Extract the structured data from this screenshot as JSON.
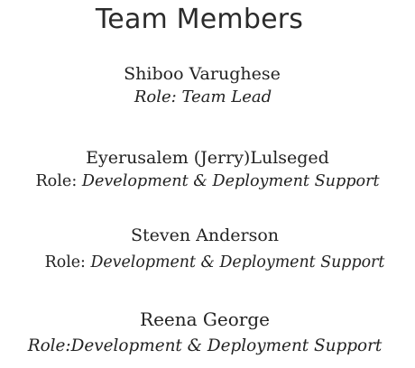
{
  "page": {
    "title": "Team Members"
  },
  "members": [
    {
      "name": "Shiboo Varughese",
      "role_prefix": "Role:",
      "role_value": " Team Lead"
    },
    {
      "name": "Eyerusalem (Jerry)Lulseged",
      "role_prefix": "Role:",
      "role_value": " Development & Deployment Support"
    },
    {
      "name": "Steven Anderson",
      "role_prefix": "Role:",
      "role_value": " Development & Deployment Support"
    },
    {
      "name": "Reena George",
      "role_prefix": "Role:",
      "role_value": "Development & Deployment Support"
    }
  ]
}
